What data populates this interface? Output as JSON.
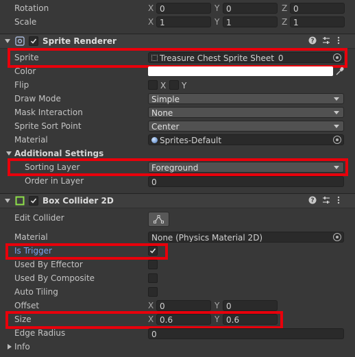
{
  "transform": {
    "rotation": {
      "label": "Rotation",
      "x": "0",
      "y": "0",
      "z": "0"
    },
    "scale": {
      "label": "Scale",
      "x": "1",
      "y": "1",
      "z": "1"
    },
    "axes": {
      "x": "X",
      "y": "Y",
      "z": "Z"
    }
  },
  "sprite_renderer": {
    "title": "Sprite Renderer",
    "enabled": true,
    "sprite": {
      "label": "Sprite",
      "value": "Treasure Chest Sprite Sheet_0"
    },
    "color": {
      "label": "Color",
      "value": "#ffffff"
    },
    "flip": {
      "label": "Flip",
      "x_label": "X",
      "y_label": "Y"
    },
    "draw_mode": {
      "label": "Draw Mode",
      "value": "Simple"
    },
    "mask_interaction": {
      "label": "Mask Interaction",
      "value": "None"
    },
    "sprite_sort_point": {
      "label": "Sprite Sort Point",
      "value": "Center"
    },
    "material": {
      "label": "Material",
      "value": "Sprites-Default"
    },
    "additional_settings": {
      "label": "Additional Settings",
      "sorting_layer": {
        "label": "Sorting Layer",
        "value": "Foreground"
      },
      "order_in_layer": {
        "label": "Order in Layer",
        "value": "0"
      }
    }
  },
  "box_collider": {
    "title": "Box Collider 2D",
    "enabled": true,
    "edit_collider": {
      "label": "Edit Collider"
    },
    "material": {
      "label": "Material",
      "value": "None (Physics Material 2D)"
    },
    "is_trigger": {
      "label": "Is Trigger",
      "checked": true
    },
    "used_by_effector": {
      "label": "Used By Effector",
      "checked": false
    },
    "used_by_composite": {
      "label": "Used By Composite",
      "checked": false
    },
    "auto_tiling": {
      "label": "Auto Tiling",
      "checked": false
    },
    "offset": {
      "label": "Offset",
      "x": "0",
      "y": "0"
    },
    "size": {
      "label": "Size",
      "x": "0.6",
      "y": "0.6"
    },
    "edge_radius": {
      "label": "Edge Radius",
      "value": "0"
    },
    "info": {
      "label": "Info"
    }
  },
  "colors": {
    "highlight": "#e8000b",
    "accent_text": "#7aa4f0",
    "background": "#383838"
  }
}
